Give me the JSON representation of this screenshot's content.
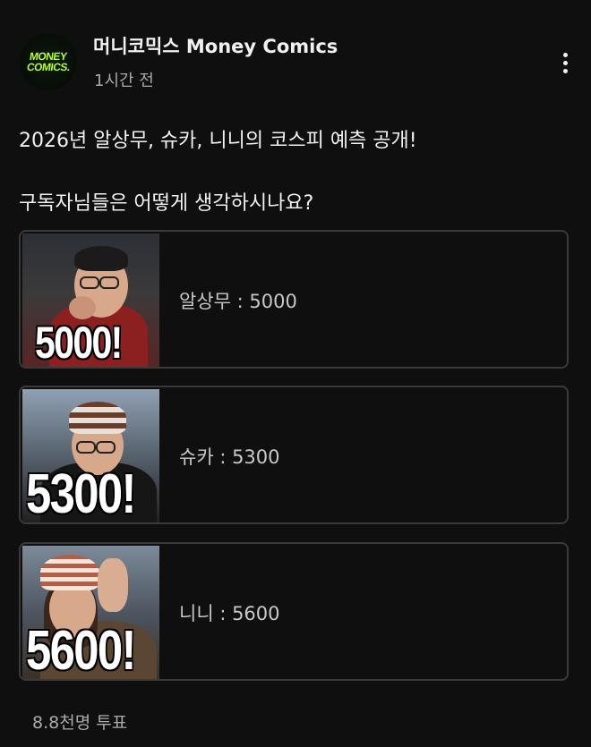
{
  "channel": {
    "avatar_text_line1": "MONEY",
    "avatar_text_line2": "COMICS.",
    "name": "머니코믹스 Money Comics",
    "time": "1시간 전"
  },
  "post": {
    "line1": "2026년 알상무, 슈카, 니니의 코스피 예측 공개!",
    "line2": "구독자님들은 어떻게 생각하시나요?"
  },
  "poll": {
    "options": [
      {
        "thumb_text": "5000!",
        "label": "알상무 : 5000"
      },
      {
        "thumb_text": "5300!",
        "label": "슈카 : 5300"
      },
      {
        "thumb_text": "5600!",
        "label": "니니 : 5600"
      }
    ],
    "votes": "8.8천명 투표"
  },
  "icons": {
    "more": "more-vert-icon"
  },
  "colors": {
    "background": "#0f0f0f",
    "avatar_accent": "#b7ff2a",
    "option_border": "#3a3a3a",
    "secondary_text": "#aaaaaa"
  }
}
